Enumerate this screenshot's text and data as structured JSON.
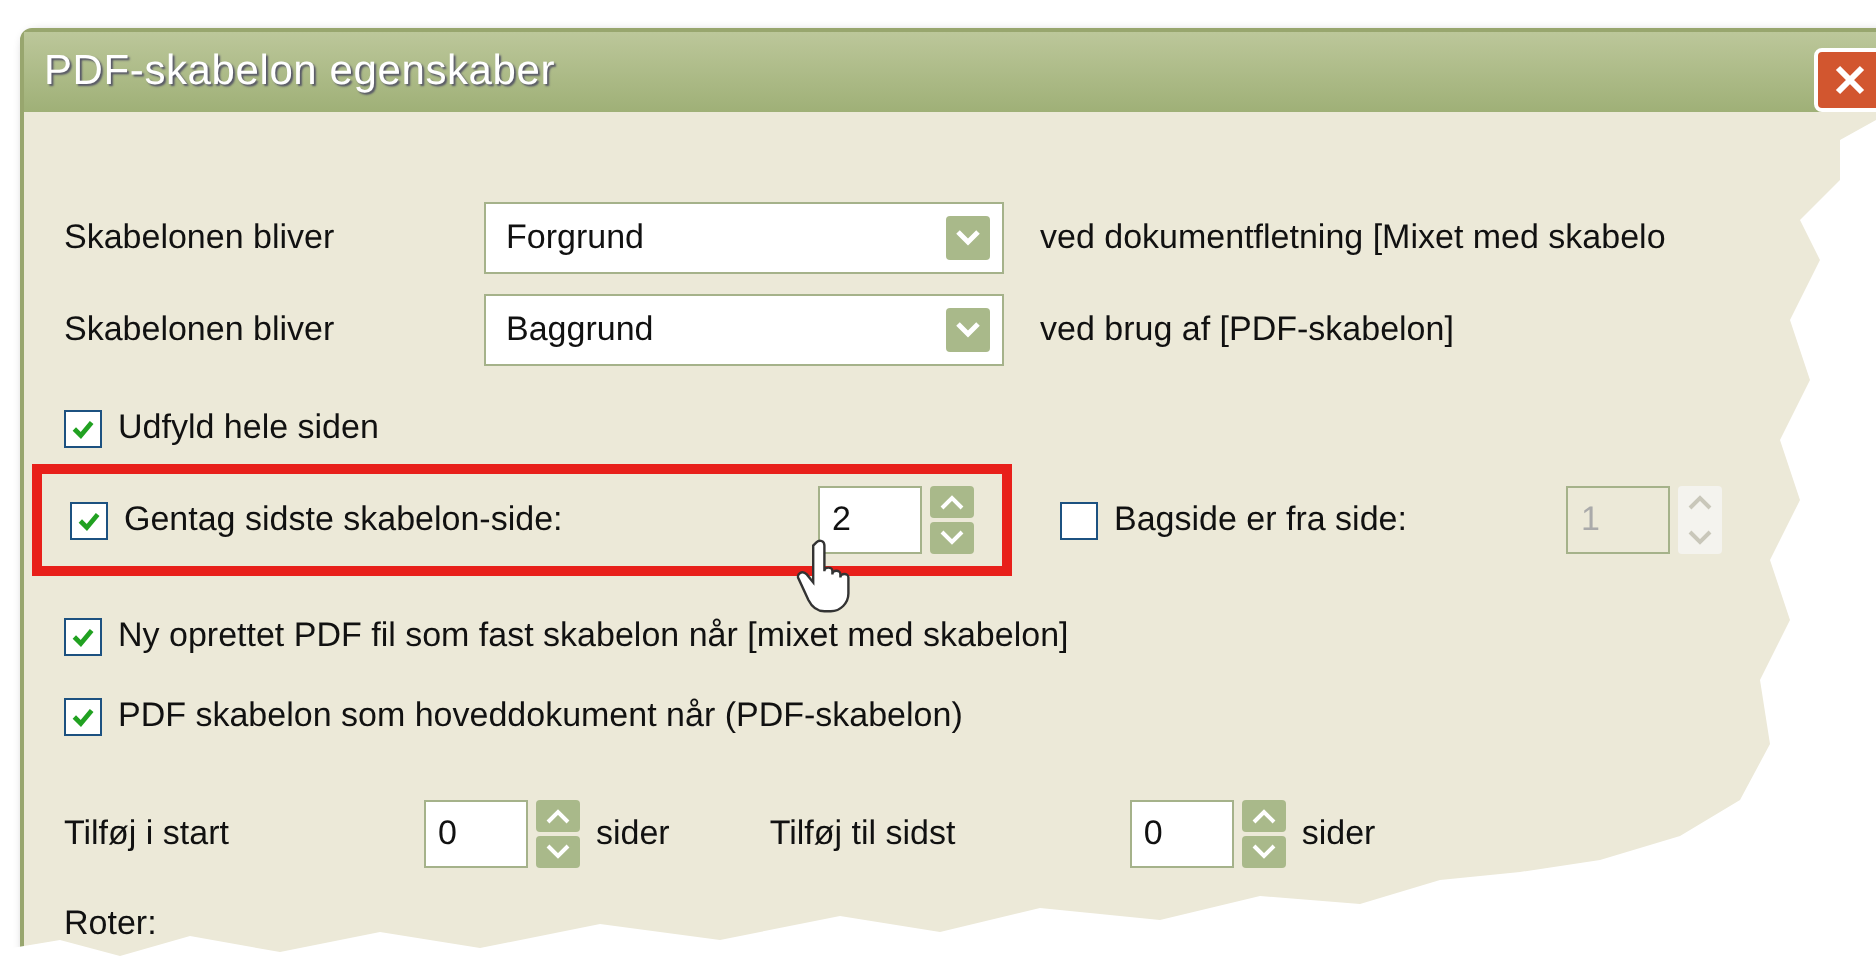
{
  "window": {
    "title": "PDF-skabelon egenskaber"
  },
  "dropdown_rows": [
    {
      "label": "Skabelonen bliver",
      "value": "Forgrund",
      "suffix": "ved dokumentfletning [Mixet med skabelo"
    },
    {
      "label": "Skabelonen bliver",
      "value": "Baggrund",
      "suffix": "ved brug af [PDF-skabelon]"
    }
  ],
  "fill_page": {
    "label": "Udfyld hele siden",
    "checked": true
  },
  "repeat_last": {
    "label": "Gentag sidste skabelon-side:",
    "checked": true,
    "value": "2",
    "highlighted": true
  },
  "back_page": {
    "label": "Bagside er fra side:",
    "checked": false,
    "value": "1",
    "disabled": true
  },
  "options": [
    {
      "label": "Ny oprettet PDF fil som fast skabelon når [mixet med skabelon]",
      "checked": true
    },
    {
      "label": "PDF skabelon som hoveddokument når (PDF-skabelon)",
      "checked": true
    }
  ],
  "add_pages": [
    {
      "label": "Tilføj i start",
      "value": "0",
      "unit": "sider"
    },
    {
      "label": "Tilføj til sidst",
      "value": "0",
      "unit": "sider"
    }
  ],
  "rotate": {
    "label": "Roter:"
  }
}
